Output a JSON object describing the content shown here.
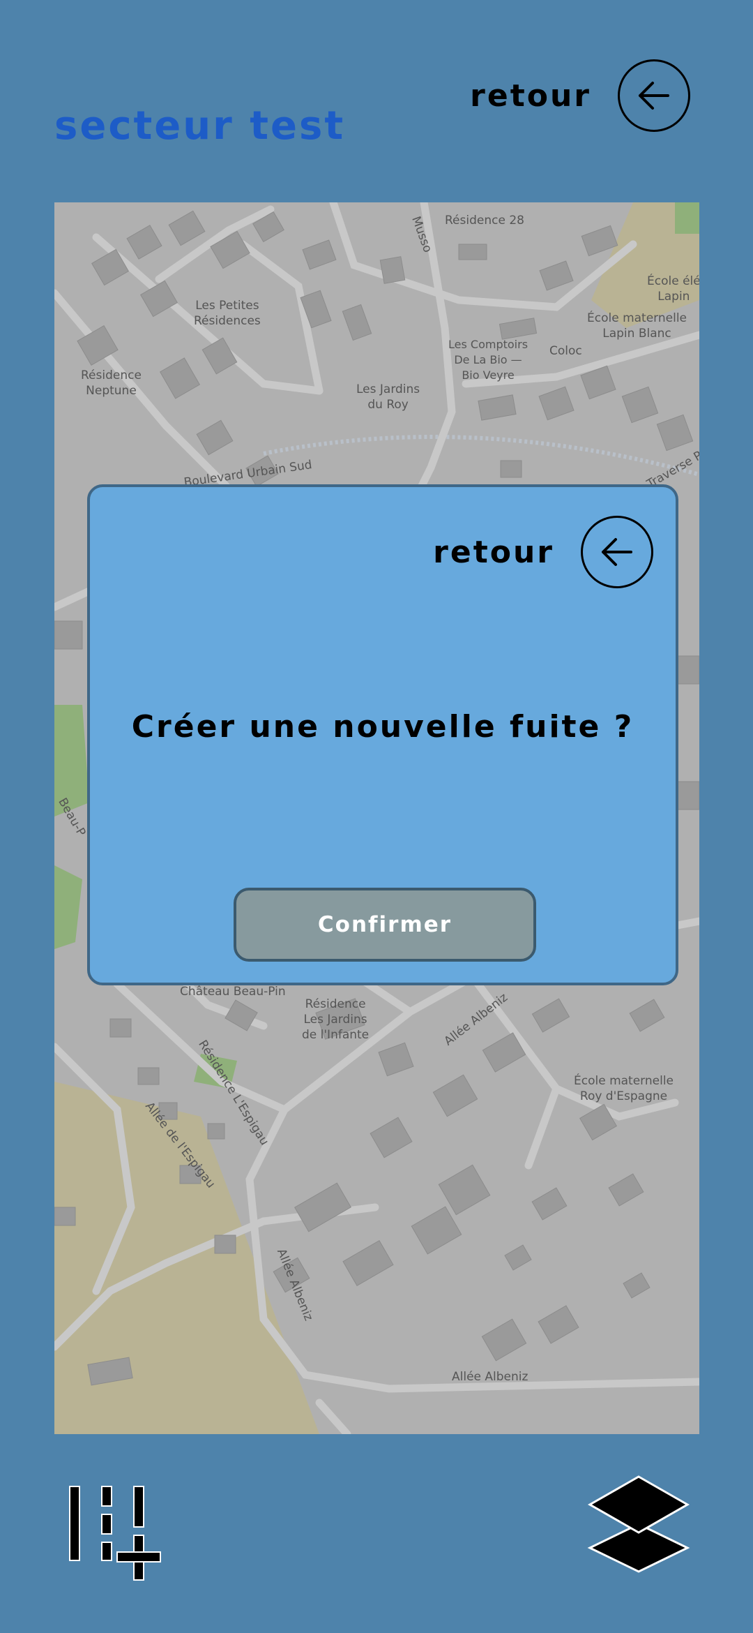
{
  "header": {
    "title": "secteur test",
    "back_label": "retour"
  },
  "map": {
    "labels": {
      "residence28": "Résidence 28",
      "musso": "Musso",
      "petites": "Les Petites\nRésidences",
      "neptune": "Résidence\nNeptune",
      "comptoirs": "Les Comptoirs\nDe La Bio —\nBio Veyre",
      "coloc": "Coloc",
      "jardins_roy": "Les Jardins\ndu Roy",
      "ecole_lapin": "École maternelle\nLapin Blanc",
      "ecole_ele": "École élé\nLapin",
      "urbain_sud": "Boulevard Urbain Sud",
      "traverse": "Traverse Po",
      "beau": "Beau-P",
      "chateau": "Château Beau-Pin",
      "infante": "Résidence\nLes Jardins\nde l'Infante",
      "albeniz1": "Allée Albeniz",
      "espigau_res": "Résidence L'Espigau",
      "espigau_allee": "Allée de l'Espigau",
      "albeniz2": "Allée Albeniz",
      "roy_espagne": "École maternelle\nRoy d'Espagne",
      "albeniz3": "Allée Albeniz"
    }
  },
  "dialog": {
    "back_label": "retour",
    "question": "Créer une nouvelle fuite ?",
    "confirm_label": "Confirmer"
  },
  "toolbar": {
    "add_icon": "add-list-icon",
    "layers_icon": "layers-icon"
  }
}
